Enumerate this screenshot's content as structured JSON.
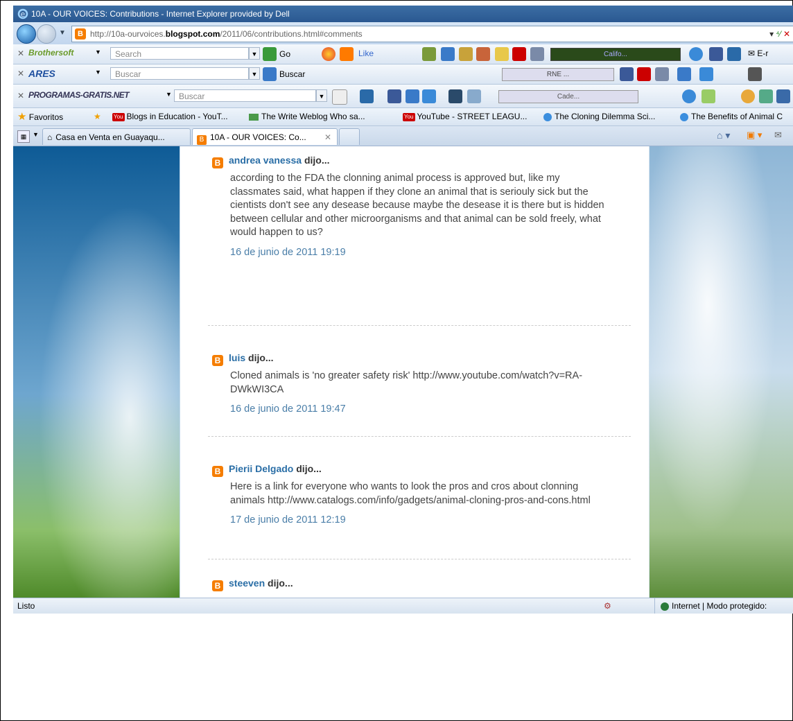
{
  "window": {
    "title": "10A - OUR VOICES: Contributions - Internet Explorer provided by Dell"
  },
  "address": {
    "url_prefix": "http://10a-ourvoices.",
    "url_domain": "blogspot.com",
    "url_suffix": "/2011/06/contributions.html#comments"
  },
  "toolbars": {
    "brothersoft": {
      "brand": "Brothersoft",
      "search_placeholder": "Search",
      "go_label": "Go",
      "like_label": "Like",
      "radio_label": "Califo...",
      "email_label": "E-r"
    },
    "ares": {
      "brand": "ARES",
      "search_placeholder": "Buscar",
      "go_label": "Buscar",
      "radio_label": "RNE ..."
    },
    "programas": {
      "brand": "PROGRAMAS-GRATIS.NET",
      "search_placeholder": "Buscar",
      "radio_label": "Cade..."
    }
  },
  "favorites": {
    "label": "Favoritos",
    "items": [
      {
        "label": "Blogs in Education - YouT...",
        "icon": "youtube-icon"
      },
      {
        "label": "The Write Weblog Who sa...",
        "icon": "weblog-icon"
      },
      {
        "label": "YouTube - STREET LEAGU...",
        "icon": "youtube-icon"
      },
      {
        "label": "The Cloning Dilemma  Sci...",
        "icon": "ie-icon"
      },
      {
        "label": "The Benefits of Animal C",
        "icon": "ie-icon"
      }
    ]
  },
  "tabs": [
    {
      "label": "Casa en Venta en Guayaqu..."
    },
    {
      "label": "10A - OUR VOICES: Co..."
    }
  ],
  "comments": [
    {
      "author": "andrea vanessa",
      "suffix": " dijo...",
      "body": "according to the FDA the clonning animal process is approved but, like my classmates said, what happen if they clone an animal that is seriouly sick but the cientists don't see any desease because maybe the desease it is there but is hidden between cellular and other microorganisms and that animal can be sold freely, what would happen to us?",
      "date": "16 de junio de 2011 19:19"
    },
    {
      "author": "luis",
      "suffix": " dijo...",
      "body": "Cloned animals is 'no greater safety risk' http://www.youtube.com/watch?v=RA-DWkWI3CA",
      "date": "16 de junio de 2011 19:47"
    },
    {
      "author": "Pierii Delgado",
      "suffix": " dijo...",
      "body": "Here is a link for everyone who wants to look the pros and cros about clonning animals http://www.catalogs.com/info/gadgets/animal-cloning-pros-and-cons.html",
      "date": "17 de junio de 2011 12:19"
    },
    {
      "author": "steeven",
      "suffix": " dijo...",
      "body": "",
      "date": ""
    }
  ],
  "status": {
    "left": "Listo",
    "zone": "Internet | Modo protegido:"
  },
  "taskbar": {
    "apps": [
      "internet-explorer-icon",
      "media-player-icon",
      "messenger-icon",
      "skype-icon",
      "image-viewer-icon",
      "word-icon"
    ]
  }
}
